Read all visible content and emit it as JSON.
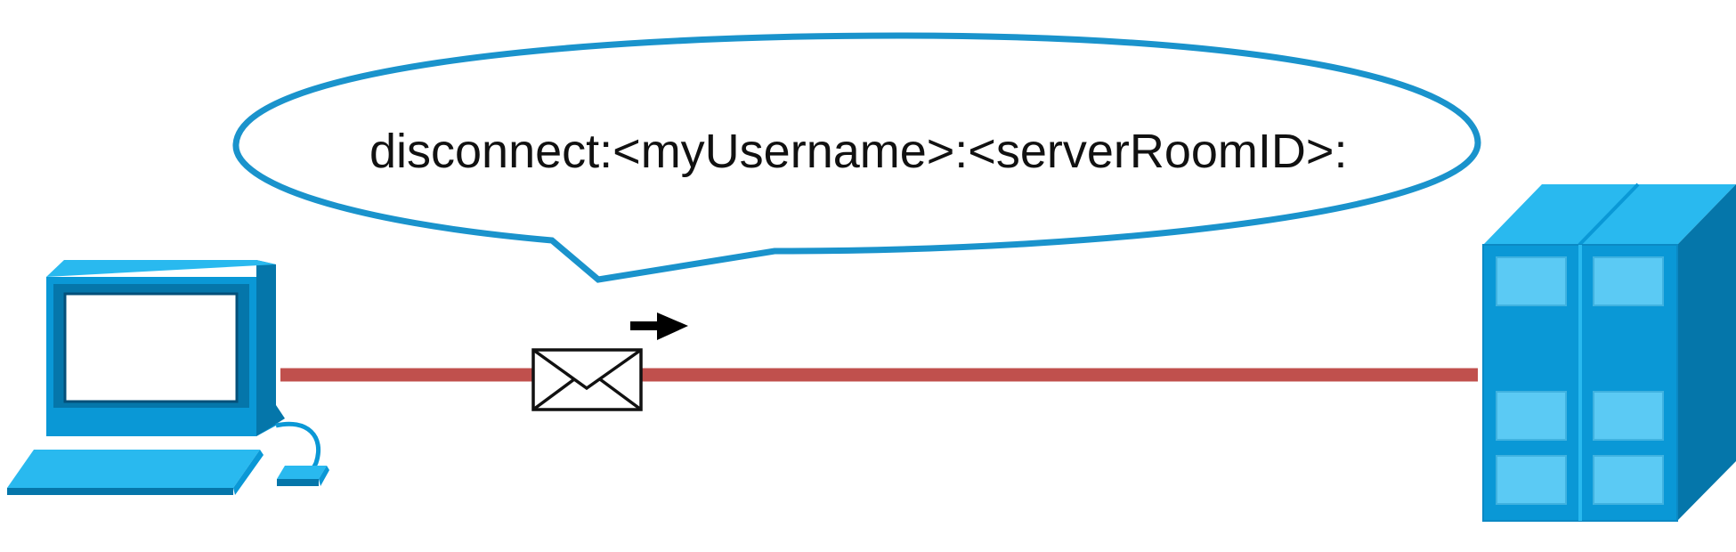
{
  "bubble": {
    "text": "disconnect:<myUsername>:<serverRoomID>:"
  },
  "colors": {
    "link": "#c0504d",
    "bubble_outline": "#1a93cc",
    "device_blue": "#0a98d6",
    "device_light": "#29b9ef",
    "device_dark": "#0576aa",
    "window": "#5bcaf4",
    "arrow": "#000000"
  },
  "icons": {
    "client": "desktop-computer-icon",
    "server": "server-tower-icon",
    "packet": "envelope-icon",
    "direction": "right-arrow-icon"
  }
}
